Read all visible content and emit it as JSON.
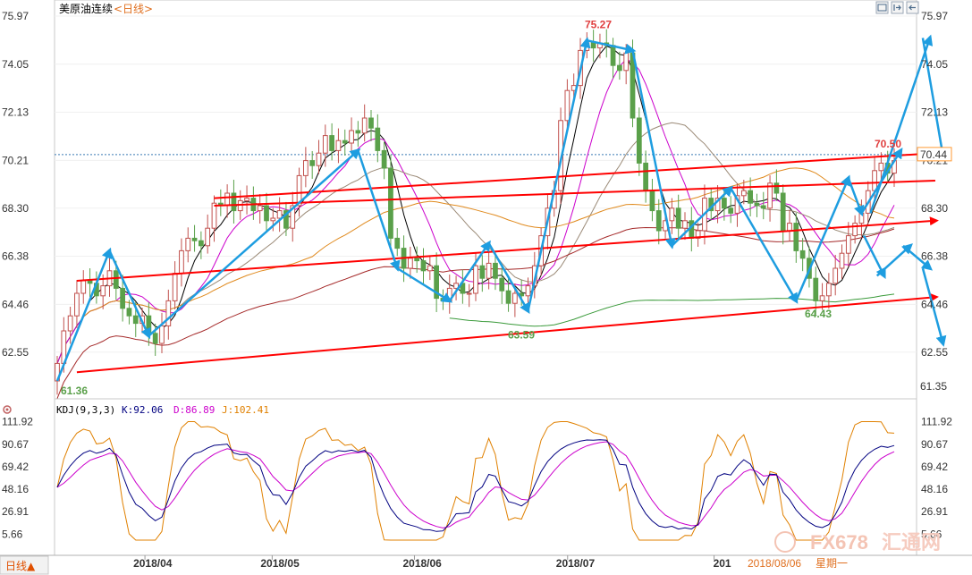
{
  "header": {
    "title": "美原油连续",
    "period": "<日线>",
    "buttons": [
      "toggle-table-button",
      "toggle-right-button",
      "back-button"
    ]
  },
  "colors": {
    "bull": "#c0504d",
    "bear": "#5aa04a",
    "trend": "#ff0000",
    "wave": "#1e9de0",
    "ma5": "#000000",
    "ma10": "#cc00cc",
    "ma20": "#9b8a77",
    "ma40": "#e08a1e",
    "ma60": "#a52a2a",
    "ma120": "#3a9a3a",
    "k": "#000080",
    "d": "#cc00cc",
    "j": "#e08000",
    "current": "#ff4444"
  },
  "chart_data": {
    "type": "candlestick",
    "ylim": [
      60.9,
      76.4
    ],
    "yticks": [
      "75.97",
      "74.05",
      "72.13",
      "70.21",
      "68.30",
      "66.38",
      "64.46",
      "62.55"
    ],
    "xlabels": [
      "2018/04",
      "2018/05",
      "2018/06",
      "2018/07",
      "201"
    ],
    "last_price": "70.44",
    "period_low_label": "61.35",
    "annotations": [
      {
        "text": "75.27",
        "value": 75.27
      },
      {
        "text": "70.50",
        "value": 70.5
      },
      {
        "text": "63.59",
        "value": 63.59
      },
      {
        "text": "64.43",
        "value": 64.43
      },
      {
        "text": "61.36",
        "value": 61.36
      }
    ],
    "closes": [
      62.1,
      63.4,
      64.0,
      64.9,
      65.4,
      65.3,
      64.8,
      65.2,
      65.8,
      65.1,
      64.3,
      64.0,
      63.7,
      64.0,
      63.3,
      62.9,
      63.6,
      64.6,
      65.7,
      66.6,
      67.1,
      67.0,
      66.8,
      67.5,
      68.5,
      68.4,
      68.9,
      68.2,
      68.6,
      68.7,
      68.2,
      68.4,
      67.8,
      67.9,
      68.2,
      67.5,
      68.4,
      69.6,
      70.2,
      70.0,
      70.5,
      71.2,
      70.6,
      71.0,
      70.9,
      71.4,
      71.3,
      71.9,
      71.5,
      70.6,
      69.9,
      67.1,
      66.7,
      65.9,
      66.3,
      66.2,
      65.8,
      66.0,
      64.7,
      64.6,
      65.1,
      65.3,
      64.9,
      64.9,
      66.0,
      65.5,
      66.1,
      65.5,
      65.0,
      64.5,
      64.9,
      64.8,
      65.2,
      66.0,
      67.2,
      68.3,
      69.0,
      71.8,
      73.0,
      73.2,
      74.6,
      74.9,
      74.7,
      74.9,
      74.8,
      74.0,
      73.8,
      74.5,
      71.9,
      70.1,
      69.0,
      68.2,
      67.4,
      67.8,
      68.3,
      67.5,
      67.8,
      67.1,
      67.4,
      68.7,
      68.2,
      68.7,
      68.3,
      68.1,
      68.8,
      69.0,
      68.5,
      68.4,
      68.3,
      69.3,
      68.9,
      67.4,
      67.7,
      66.6,
      66.3,
      65.5,
      64.6,
      64.8,
      65.3,
      65.9,
      66.5,
      67.2,
      67.7,
      68.1,
      69.0,
      69.8,
      70.1,
      69.7,
      70.2
    ],
    "highs_lows": {
      "low_index": 0,
      "high_index": 79
    },
    "trendlines": [
      {
        "name": "upper",
        "from": [
          24,
          68.7
        ],
        "to": [
          131,
          70.5
        ]
      },
      {
        "name": "middle",
        "from": [
          3,
          65.4
        ],
        "to": [
          131,
          67.8
        ]
      },
      {
        "name": "lower",
        "from": [
          3,
          61.75
        ],
        "to": [
          131,
          64.75
        ]
      },
      {
        "name": "inner",
        "from": [
          24,
          68.4
        ],
        "to": [
          131,
          69.4
        ]
      }
    ],
    "wave_points": [
      [
        0,
        61.4
      ],
      [
        8,
        66.6
      ],
      [
        14,
        63.2
      ],
      [
        46,
        70.6
      ],
      [
        52,
        65.9
      ],
      [
        60,
        64.6
      ],
      [
        66,
        66.9
      ],
      [
        72,
        64.2
      ],
      [
        81,
        75.0
      ],
      [
        88,
        74.6
      ],
      [
        94,
        66.8
      ],
      [
        103,
        69.1
      ],
      [
        113,
        64.6
      ],
      [
        121,
        69.5
      ],
      [
        123,
        68.1
      ],
      [
        129,
        70.6
      ]
    ],
    "projection_points": [
      [
        123,
        68.1
      ],
      [
        131,
        75.1
      ],
      [
        133,
        70.4
      ],
      [
        122,
        67.2
      ],
      [
        124,
        65.6
      ],
      [
        128,
        66.8
      ],
      [
        131,
        65.9
      ],
      [
        133,
        62.9
      ]
    ],
    "kdj": {
      "label": "KDJ(9,3,3)",
      "k_text": "K:92.06",
      "d_text": "D:86.89",
      "j_text": "J:102.41",
      "ylim": [
        0,
        115
      ],
      "yticks": [
        "111.92",
        "90.67",
        "69.42",
        "48.16",
        "26.91",
        "5.66"
      ]
    },
    "footer": {
      "period_tab": "日线▲",
      "date": "2018/08/06",
      "weekday": "星期一"
    }
  },
  "watermark": {
    "text": "FX678",
    "cn": "汇通网"
  }
}
